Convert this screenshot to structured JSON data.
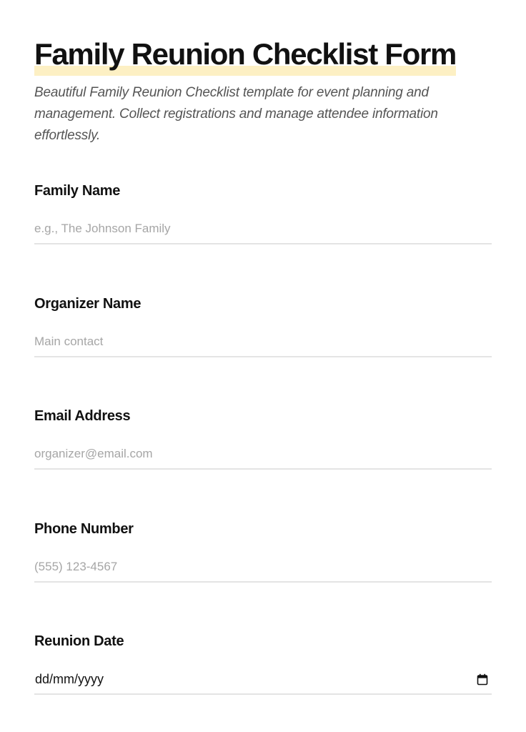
{
  "form": {
    "title": "Family Reunion Checklist Form",
    "description": "Beautiful Family Reunion Checklist template for event planning and management. Collect registrations and manage attendee information effortlessly.",
    "fields": [
      {
        "label": "Family Name",
        "placeholder": "e.g., The Johnson Family"
      },
      {
        "label": "Organizer Name",
        "placeholder": "Main contact"
      },
      {
        "label": "Email Address",
        "placeholder": "organizer@email.com"
      },
      {
        "label": "Phone Number",
        "placeholder": "(555) 123-4567"
      }
    ],
    "date_field": {
      "label": "Reunion Date",
      "format": "dd/mm/yyyy",
      "icon": "calendar-icon"
    }
  },
  "colors": {
    "title_highlight": "#fdf0c4",
    "text": "#111111",
    "description": "#555555",
    "placeholder": "#a6a6a6",
    "underline": "#e4e4e4"
  }
}
